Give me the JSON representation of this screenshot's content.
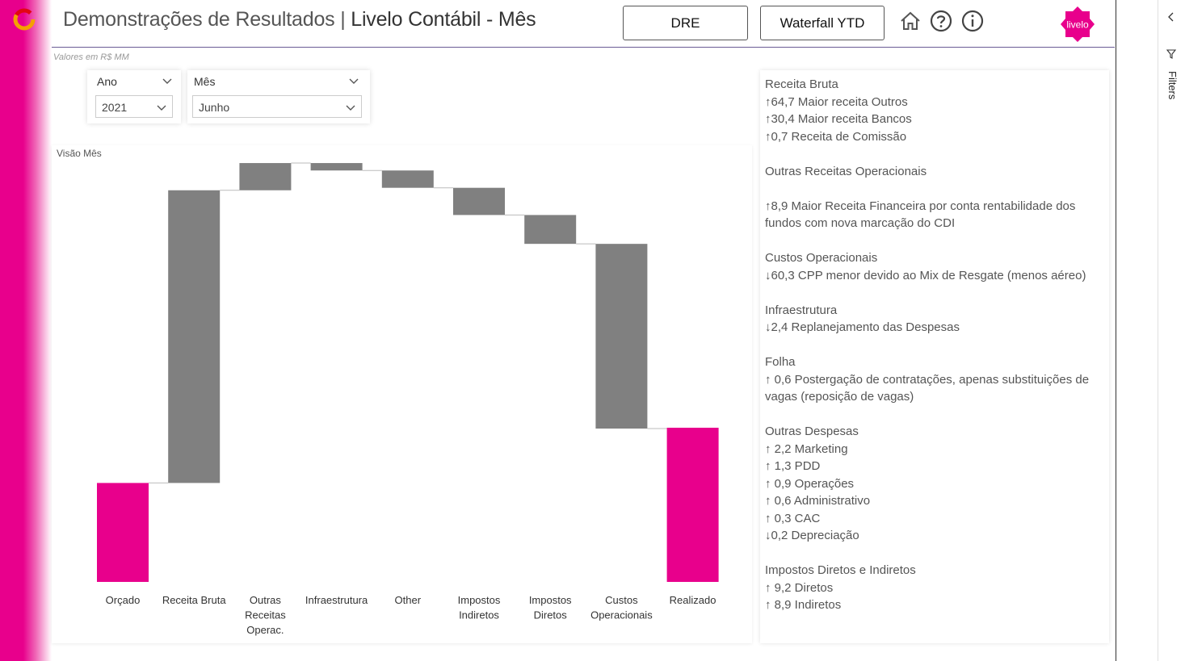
{
  "header": {
    "title_part1": "Demonstrações de Resultados",
    "title_sep": " | ",
    "title_part2": "Livelo Contábil - Mês",
    "buttons": {
      "dre": "DRE",
      "waterfall": "Waterfall YTD"
    },
    "icons": [
      "home-icon",
      "help-icon",
      "info-icon"
    ],
    "brand_logo_text": "livelo",
    "accent_color": "#e8008c"
  },
  "subtitle": "Valores em R$ MM",
  "slicers": {
    "year": {
      "label": "Ano",
      "value": "2021"
    },
    "month": {
      "label": "Mês",
      "value": "Junho"
    }
  },
  "chart_data": {
    "type": "waterfall",
    "title": "Visão Mês",
    "categories": [
      "Orçado",
      "Receita Bruta",
      "Outras Receitas Operac.",
      "Infraestrutura",
      "Other",
      "Impostos Indiretos",
      "Impostos Diretos",
      "Custos Operacionais",
      "Realizado"
    ],
    "category_lines": [
      [
        "Orçado"
      ],
      [
        "Receita Bruta"
      ],
      [
        "Outras",
        "Receitas",
        "Operac."
      ],
      [
        "Infraestrutura"
      ],
      [
        "Other"
      ],
      [
        "Impostos",
        "Indiretos"
      ],
      [
        "Impostos",
        "Diretos"
      ],
      [
        "Custos",
        "Operacionais"
      ],
      [
        "Realizado"
      ]
    ],
    "values": [
      24,
      71,
      6.6,
      -1.8,
      -4.2,
      -6.6,
      -7.0,
      -44.8,
      37.4
    ],
    "kinds": [
      "total",
      "delta",
      "delta",
      "delta",
      "delta",
      "delta",
      "delta",
      "delta",
      "total"
    ],
    "colors": {
      "total": "#e8008c",
      "delta": "#808080",
      "connector": "#bbbbbb"
    },
    "ylim": [
      0,
      102
    ],
    "grid": false,
    "legend": "none"
  },
  "commentary": [
    {
      "head": "Receita Bruta",
      "lines": [
        "↑64,7 Maior receita Outros",
        "↑30,4 Maior receita Bancos",
        "↑0,7 Receita de Comissão"
      ]
    },
    {
      "head": "Outras Receitas Operacionais",
      "lines": [
        "",
        "↑8,9 Maior Receita Financeira por conta rentabilidade dos fundos com nova marcação do CDI"
      ]
    },
    {
      "head": "Custos Operacionais",
      "lines": [
        "↓60,3 CPP menor devido ao Mix de Resgate (menos aéreo)"
      ]
    },
    {
      "head": "Infraestrutura",
      "lines": [
        "↓2,4 Replanejamento das Despesas"
      ]
    },
    {
      "head": "Folha",
      "lines": [
        "↑ 0,6 Postergação de contratações, apenas substituições de vagas (reposição de vagas)"
      ]
    },
    {
      "head": "Outras Despesas",
      "lines": [
        "↑ 2,2 Marketing",
        "↑ 1,3 PDD",
        "↑ 0,9 Operações",
        "↑ 0,6 Administrativo",
        "↑ 0,3 CAC",
        "↓0,2 Depreciação"
      ]
    },
    {
      "head": "Impostos Diretos e Indiretos",
      "lines": [
        "↑ 9,2 Diretos",
        "↑ 8,9 Indiretos"
      ]
    }
  ],
  "filters_pane": {
    "label": "Filters"
  }
}
